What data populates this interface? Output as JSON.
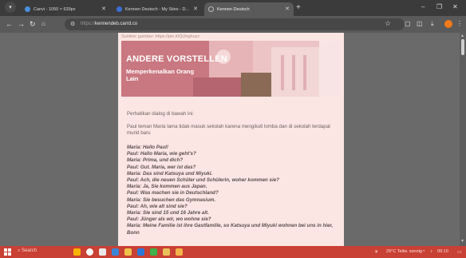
{
  "browser": {
    "tabs": [
      {
        "title": "Canvi - 1050 × 639px",
        "active": false,
        "favicon_color": "#4a90e2"
      },
      {
        "title": "Kennen Deutsch - My Sites - D...",
        "active": false,
        "favicon_color": "#3b6fd6"
      },
      {
        "title": "Kennen Deutsch",
        "active": true,
        "favicon_color": "#9a9a9a"
      }
    ],
    "url_prefix": "https://",
    "url_domain": "kennendeb.carrd.co",
    "icons": {
      "back": "arrow-left-icon",
      "forward": "arrow-right-icon",
      "reload": "reload-icon",
      "home": "home-icon",
      "site_info": "tune-icon",
      "bookmark": "star-icon",
      "extensions": "puzzle-icon",
      "download": "download-icon"
    }
  },
  "page": {
    "image_source": "Sumber gambar: https://pin.it/QUhghuzz",
    "banner_title": "ANDERE VORSTELLEN",
    "banner_subtitle": "Memperkenalkan Orang Lain",
    "intro": "Perhatikan dialog di bawah ini:",
    "context": "Paul teman Maria lama tidak masuk sekolah karena mengikuti lomba dan di sekolah terdapat murid baru",
    "dialog": [
      "Maria: Hallo Paul!",
      "Paul: Hallo Maria, wie geht's?",
      "Maria: Prima, und dich?",
      "Paul: Gut. Maria, wer ist das?",
      "Maria: Das sind Katsuya und Miyuki.",
      "Paul: Ach, die neuen Schüler und Schülerin, woher kommen sie?",
      "Maria: Ja, Sie kommen aus Japan.",
      "Paul: Was machen sie in Deutschland?",
      "Maria: Sie besuchen das Gymnasium.",
      "Paul: Ah, wie alt sind sie?",
      "Maria: Sie sind 15 und 16 Jahre alt.",
      "Paul: Jünger als wir, wo wohne sie?",
      "Maria: Meine Familie ist ihre Gastfamilie, so Katsuya und Miyuki wohnen bei uns in hier, Bonn"
    ]
  },
  "taskbar": {
    "search_label": "Search",
    "weather": "29°C  Teilw. sonnig",
    "clock": "09:10"
  },
  "colors": {
    "card_bg": "#fbe6e3",
    "taskbar": "#c94034",
    "tab_strip": "#3b3b3b"
  }
}
